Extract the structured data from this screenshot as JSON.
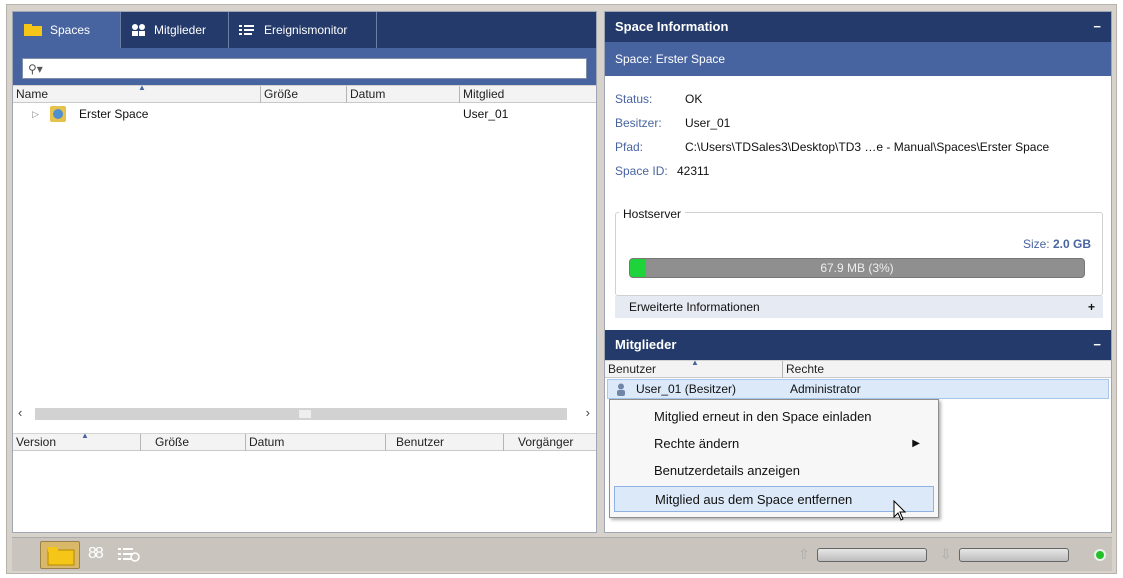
{
  "tabs": [
    {
      "label": "Spaces",
      "icon": "folder-icon",
      "active": true
    },
    {
      "label": "Mitglieder",
      "icon": "people-icon",
      "active": false
    },
    {
      "label": "Ereignismonitor",
      "icon": "event-monitor-icon",
      "active": false
    }
  ],
  "search": {
    "placeholder": ""
  },
  "spaces_table": {
    "columns": [
      "Name",
      "Größe",
      "Datum",
      "Mitglied"
    ],
    "rows": [
      {
        "name": "Erster Space",
        "size": "",
        "date": "",
        "member": "User_01"
      }
    ]
  },
  "versions_table": {
    "columns": [
      "Version",
      "Größe",
      "Datum",
      "Benutzer",
      "Vorgänger"
    ]
  },
  "space_info": {
    "title": "Space Information",
    "space_line": "Space:  Erster Space",
    "status_label": "Status:",
    "status_value": "OK",
    "owner_label": "Besitzer:",
    "owner_value": "User_01",
    "path_label": "Pfad:",
    "path_value": "C:\\Users\\TDSales3\\Desktop\\TD3 …e - Manual\\Spaces\\Erster Space",
    "id_label": "Space ID:",
    "id_value": "42311",
    "host_label": "Hostserver",
    "size_prefix": "Size:",
    "size_value": "2.0 GB",
    "usage_text": "67.9 MB (3%)",
    "usage_fraction": 0.03,
    "advanced_label": "Erweiterte Informationen"
  },
  "members_panel": {
    "title": "Mitglieder",
    "columns": [
      "Benutzer",
      "Rechte"
    ],
    "rows": [
      {
        "user": "User_01 (Besitzer)",
        "rights": "Administrator"
      }
    ]
  },
  "context_menu": {
    "items": [
      {
        "label": "Mitglied erneut in den Space einladen",
        "submenu": false
      },
      {
        "label": "Rechte ändern",
        "submenu": true
      },
      {
        "label": "Benutzerdetails anzeigen",
        "submenu": false
      },
      {
        "label": "Mitglied aus dem Space entfernen",
        "submenu": false,
        "hover": true
      }
    ]
  },
  "colors": {
    "header_dark": "#233a6b",
    "header_mid": "#4864a0",
    "progress_green": "#1fd43a",
    "status_green": "#24c02a"
  }
}
